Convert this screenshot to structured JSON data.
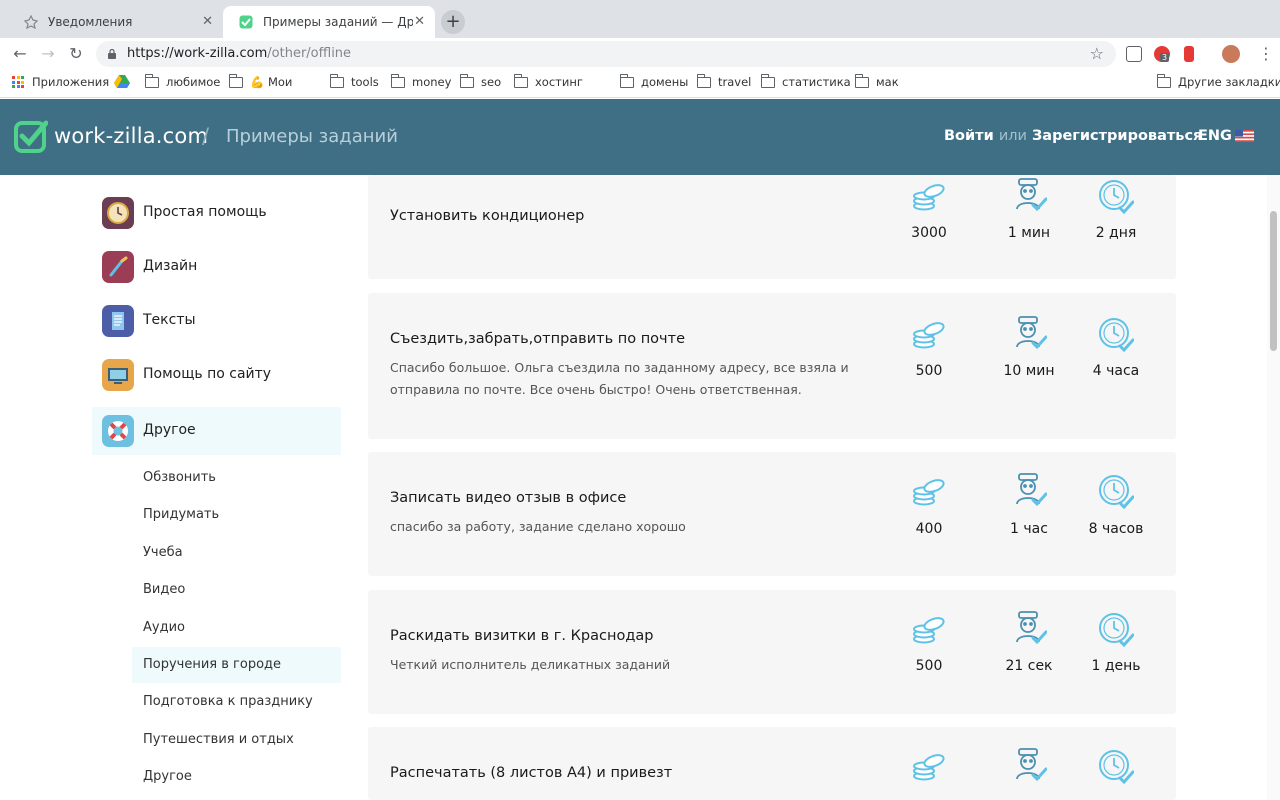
{
  "browser": {
    "tabs": [
      {
        "title": "Уведомления",
        "active": false
      },
      {
        "title": "Примеры заданий — Другие",
        "active": true
      }
    ],
    "url_host": "https://work-zilla.com",
    "url_path": "/other/offline",
    "ext_badge": "3",
    "bookmarks": [
      {
        "label": "Приложения",
        "type": "apps"
      },
      {
        "label": "любимое",
        "type": "folder"
      },
      {
        "label": "💪 Мои",
        "type": "folder"
      },
      {
        "label": "tools",
        "type": "folder"
      },
      {
        "label": "money",
        "type": "folder"
      },
      {
        "label": "seo",
        "type": "folder"
      },
      {
        "label": "хостинг",
        "type": "folder"
      },
      {
        "label": "домены",
        "type": "folder"
      },
      {
        "label": "travel",
        "type": "folder"
      },
      {
        "label": "статистика",
        "type": "folder"
      },
      {
        "label": "мак",
        "type": "folder"
      },
      {
        "label": "Другие закладки",
        "type": "folder"
      }
    ]
  },
  "header": {
    "logo": "work-zilla.com",
    "breadcrumb": "Примеры заданий",
    "login": "Войти",
    "or": "или",
    "register": "Зарегистрироваться",
    "lang": "ENG"
  },
  "sidebar": {
    "categories": [
      {
        "label": "Простая помощь",
        "icon": "clock-icon",
        "color": "#6b3d52"
      },
      {
        "label": "Дизайн",
        "icon": "brush-icon",
        "color": "#9b3e55"
      },
      {
        "label": "Тексты",
        "icon": "document-icon",
        "color": "#4c5ea8"
      },
      {
        "label": "Помощь по сайту",
        "icon": "monitor-icon",
        "color": "#e8a64a"
      },
      {
        "label": "Другое",
        "icon": "lifebuoy-icon",
        "color": "#6dc0e0"
      }
    ],
    "subitems": [
      "Обзвонить",
      "Придумать",
      "Учеба",
      "Видео",
      "Аудио",
      "Поручения в городе",
      "Подготовка к празднику",
      "Путешествия и отдых",
      "Другое"
    ]
  },
  "cards": [
    {
      "title": "Установить кондиционер",
      "desc": "",
      "price": "3000",
      "response": "1 мин",
      "duration": "2 дня"
    },
    {
      "title": "Съездить,забрать,отправить по почте",
      "desc": "Спасибо большое. Ольга съездила по заданному адресу, все взяла и отправила по почте. Все очень быстро! Очень ответственная.",
      "price": "500",
      "response": "10 мин",
      "duration": "4 часа"
    },
    {
      "title": "Записать видео отзыв в офисе",
      "desc": "спасибо за работу, задание сделано хорошо",
      "price": "400",
      "response": "1 час",
      "duration": "8 часов"
    },
    {
      "title": "Раскидать визитки в г. Краснодар",
      "desc": "Четкий исполнитель деликатных заданий",
      "price": "500",
      "response": "21 сек",
      "duration": "1 день"
    },
    {
      "title": "Распечатать (8 листов А4) и привезт",
      "desc": "",
      "price": "",
      "response": "",
      "duration": ""
    }
  ],
  "colors": {
    "header_bg": "#3f6f85",
    "accent": "#5ec2e8",
    "logo_green": "#4fd28a",
    "active_bg": "#eefafb",
    "card_bg": "#f6f6f6"
  }
}
